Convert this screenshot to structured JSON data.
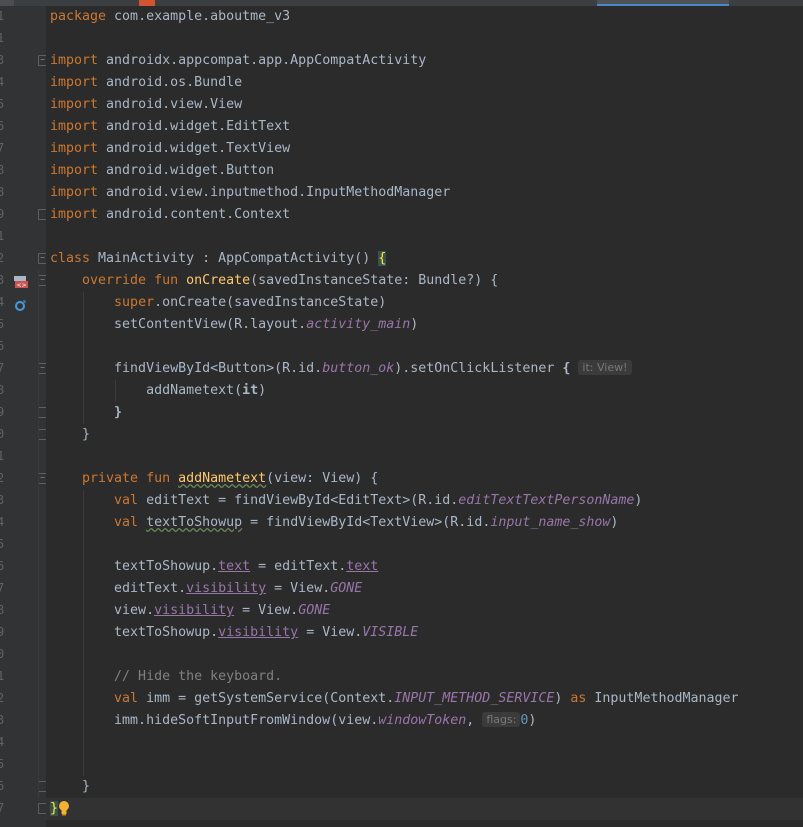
{
  "editor": {
    "lines": [
      {
        "n": "1",
        "fold": "",
        "parts": [
          {
            "t": "package ",
            "c": "kw"
          },
          {
            "t": "com.example.aboutme_v3"
          }
        ]
      },
      {
        "n": "1",
        "fold": "",
        "parts": []
      },
      {
        "n": "3",
        "fold": "open",
        "parts": [
          {
            "t": "import ",
            "c": "kw"
          },
          {
            "t": "androidx.appcompat.app.AppCompatActivity"
          }
        ]
      },
      {
        "n": "4",
        "fold": "",
        "parts": [
          {
            "t": "import ",
            "c": "kw"
          },
          {
            "t": "android.os.Bundle"
          }
        ]
      },
      {
        "n": "5",
        "fold": "",
        "parts": [
          {
            "t": "import ",
            "c": "kw"
          },
          {
            "t": "android.view.View"
          }
        ]
      },
      {
        "n": "6",
        "fold": "",
        "parts": [
          {
            "t": "import ",
            "c": "kw"
          },
          {
            "t": "android.widget.EditText"
          }
        ]
      },
      {
        "n": "7",
        "fold": "",
        "parts": [
          {
            "t": "import ",
            "c": "kw"
          },
          {
            "t": "android.widget.TextView"
          }
        ]
      },
      {
        "n": "8",
        "fold": "",
        "parts": [
          {
            "t": "import ",
            "c": "kw"
          },
          {
            "t": "android.widget.Button"
          }
        ]
      },
      {
        "n": "8",
        "fold": "",
        "parts": [
          {
            "t": "import ",
            "c": "kw"
          },
          {
            "t": "android.view.inputmethod.InputMethodManager"
          }
        ]
      },
      {
        "n": "9",
        "fold": "close",
        "parts": [
          {
            "t": "import ",
            "c": "kw"
          },
          {
            "t": "android.content.Context"
          }
        ]
      },
      {
        "n": "1",
        "fold": "",
        "parts": []
      },
      {
        "n": "2",
        "fold": "open",
        "parts": [
          {
            "t": "class ",
            "c": "kw"
          },
          {
            "t": "MainActivity : AppCompatActivity() "
          },
          {
            "t": "{",
            "c": "brace"
          }
        ]
      },
      {
        "n": "3",
        "fold": "open",
        "parts": [
          {
            "t": "    override fun ",
            "c": "kw"
          },
          {
            "t": "onCreate",
            "c": "fn"
          },
          {
            "t": "(savedInstanceState: Bundle?) {"
          }
        ]
      },
      {
        "n": "4",
        "fold": "",
        "parts": [
          {
            "t": "        "
          },
          {
            "t": "super",
            "c": "kw"
          },
          {
            "t": ".onCreate(savedInstanceState)"
          }
        ]
      },
      {
        "n": "5",
        "fold": "",
        "parts": [
          {
            "t": "        setContentView(R.layout."
          },
          {
            "t": "activity_main",
            "c": "field"
          },
          {
            "t": ")"
          }
        ]
      },
      {
        "n": "6",
        "fold": "",
        "parts": []
      },
      {
        "n": "7",
        "fold": "open",
        "parts": [
          {
            "t": "        findViewById<Button>(R.id."
          },
          {
            "t": "button_ok",
            "c": "field"
          },
          {
            "t": ").setOnClickListener "
          },
          {
            "t": "{",
            "c": "bold"
          },
          {
            "t": " "
          },
          {
            "t": "it: View!",
            "c": "hint"
          }
        ]
      },
      {
        "n": "8",
        "fold": "",
        "parts": [
          {
            "t": "            addNametext("
          },
          {
            "t": "it",
            "c": "bold"
          },
          {
            "t": ")"
          }
        ]
      },
      {
        "n": "9",
        "fold": "close",
        "parts": [
          {
            "t": "        "
          },
          {
            "t": "}",
            "c": "bold"
          }
        ]
      },
      {
        "n": "0",
        "fold": "close",
        "parts": [
          {
            "t": "    }"
          }
        ]
      },
      {
        "n": "1",
        "fold": "",
        "parts": []
      },
      {
        "n": "2",
        "fold": "open",
        "parts": [
          {
            "t": "    private fun ",
            "c": "kw"
          },
          {
            "t": "addNametext",
            "c": "fn wavy"
          },
          {
            "t": "(view: View) {"
          }
        ]
      },
      {
        "n": "3",
        "fold": "",
        "parts": [
          {
            "t": "        "
          },
          {
            "t": "val ",
            "c": "kw"
          },
          {
            "t": "editText = findViewById<EditText>(R.id."
          },
          {
            "t": "editTextTextPersonName",
            "c": "field"
          },
          {
            "t": ")"
          }
        ]
      },
      {
        "n": "4",
        "fold": "",
        "parts": [
          {
            "t": "        "
          },
          {
            "t": "val ",
            "c": "kw"
          },
          {
            "t": "textToShowup",
            "c": "wavy"
          },
          {
            "t": " = findViewById<TextView>(R.id."
          },
          {
            "t": "input_name_show",
            "c": "field"
          },
          {
            "t": ")"
          }
        ]
      },
      {
        "n": "5",
        "fold": "",
        "parts": []
      },
      {
        "n": "6",
        "fold": "",
        "parts": [
          {
            "t": "        textToShowup."
          },
          {
            "t": "text",
            "c": "prop"
          },
          {
            "t": " = editText."
          },
          {
            "t": "text",
            "c": "prop"
          }
        ]
      },
      {
        "n": "7",
        "fold": "",
        "parts": [
          {
            "t": "        editText."
          },
          {
            "t": "visibility",
            "c": "prop"
          },
          {
            "t": " = View."
          },
          {
            "t": "GONE",
            "c": "field"
          }
        ]
      },
      {
        "n": "8",
        "fold": "",
        "parts": [
          {
            "t": "        view."
          },
          {
            "t": "visibility",
            "c": "prop"
          },
          {
            "t": " = View."
          },
          {
            "t": "GONE",
            "c": "field"
          }
        ]
      },
      {
        "n": "9",
        "fold": "",
        "parts": [
          {
            "t": "        textToShowup."
          },
          {
            "t": "visibility",
            "c": "prop"
          },
          {
            "t": " = View."
          },
          {
            "t": "VISIBLE",
            "c": "field"
          }
        ]
      },
      {
        "n": "0",
        "fold": "",
        "parts": []
      },
      {
        "n": "1",
        "fold": "",
        "parts": [
          {
            "t": "        // Hide the keyboard.",
            "c": "cmt"
          }
        ]
      },
      {
        "n": "2",
        "fold": "",
        "parts": [
          {
            "t": "        "
          },
          {
            "t": "val ",
            "c": "kw"
          },
          {
            "t": "imm = getSystemService(Context."
          },
          {
            "t": "INPUT_METHOD_SERVICE",
            "c": "field"
          },
          {
            "t": ") "
          },
          {
            "t": "as ",
            "c": "kw"
          },
          {
            "t": "InputMethodManager"
          }
        ]
      },
      {
        "n": "3",
        "fold": "",
        "parts": [
          {
            "t": "        imm.hideSoftInputFromWindow(view."
          },
          {
            "t": "windowToken",
            "c": "field"
          },
          {
            "t": ", "
          },
          {
            "t": "flags:",
            "c": "hint"
          },
          {
            "t": "0",
            "c": "num"
          },
          {
            "t": ")"
          }
        ]
      },
      {
        "n": "4",
        "fold": "",
        "parts": []
      },
      {
        "n": "5",
        "fold": "",
        "parts": []
      },
      {
        "n": "6",
        "fold": "close",
        "parts": [
          {
            "t": "    }"
          }
        ]
      },
      {
        "n": "7",
        "fold": "close",
        "parts": [
          {
            "t": "}",
            "c": "brace"
          }
        ]
      }
    ]
  },
  "gutter_icons": {
    "line_12": "android-activity-icon",
    "line_13": "override-method-icon",
    "line_36": "lightbulb-intention-icon"
  },
  "colors": {
    "background": "#2b2b2b",
    "keyword": "#cc7832",
    "function": "#ffc66d",
    "field": "#9876aa",
    "comment": "#808080",
    "text": "#a9b7c6"
  }
}
